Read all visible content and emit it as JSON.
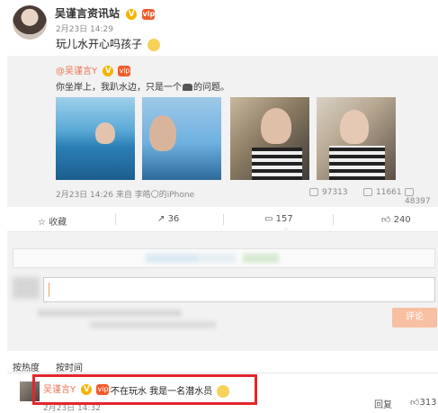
{
  "post": {
    "author": "吴谨言资讯站",
    "badge_v": "V",
    "badge_vip": "vip",
    "time": "2月23日 14:29",
    "text": "玩儿水开心吗孩子"
  },
  "repost": {
    "author": "@吴谨言Y",
    "text_before": "你坐岸上，我趴水边，只是一个",
    "text_after": "的问题。",
    "meta": "2月23日 14:26 来自 李皓〇的iPhone",
    "stats": {
      "reposts": "97313",
      "comments": "11661",
      "likes": "48397"
    }
  },
  "actions": {
    "favorite": "收藏",
    "repost": "36",
    "comment": "157",
    "like": "240"
  },
  "comment_box": {
    "submit": "评论"
  },
  "tabs": {
    "hot": "按热度",
    "time": "按时间"
  },
  "comment": {
    "author": "吴谨言Y",
    "text": "不在玩水 我是一名潜水员",
    "time": "2月23日 14:32",
    "reply": "回复",
    "likes": "313"
  },
  "colors": {
    "accent": "#eb7350",
    "highlight": "#e3262b",
    "panel": "#f2f2f2"
  }
}
